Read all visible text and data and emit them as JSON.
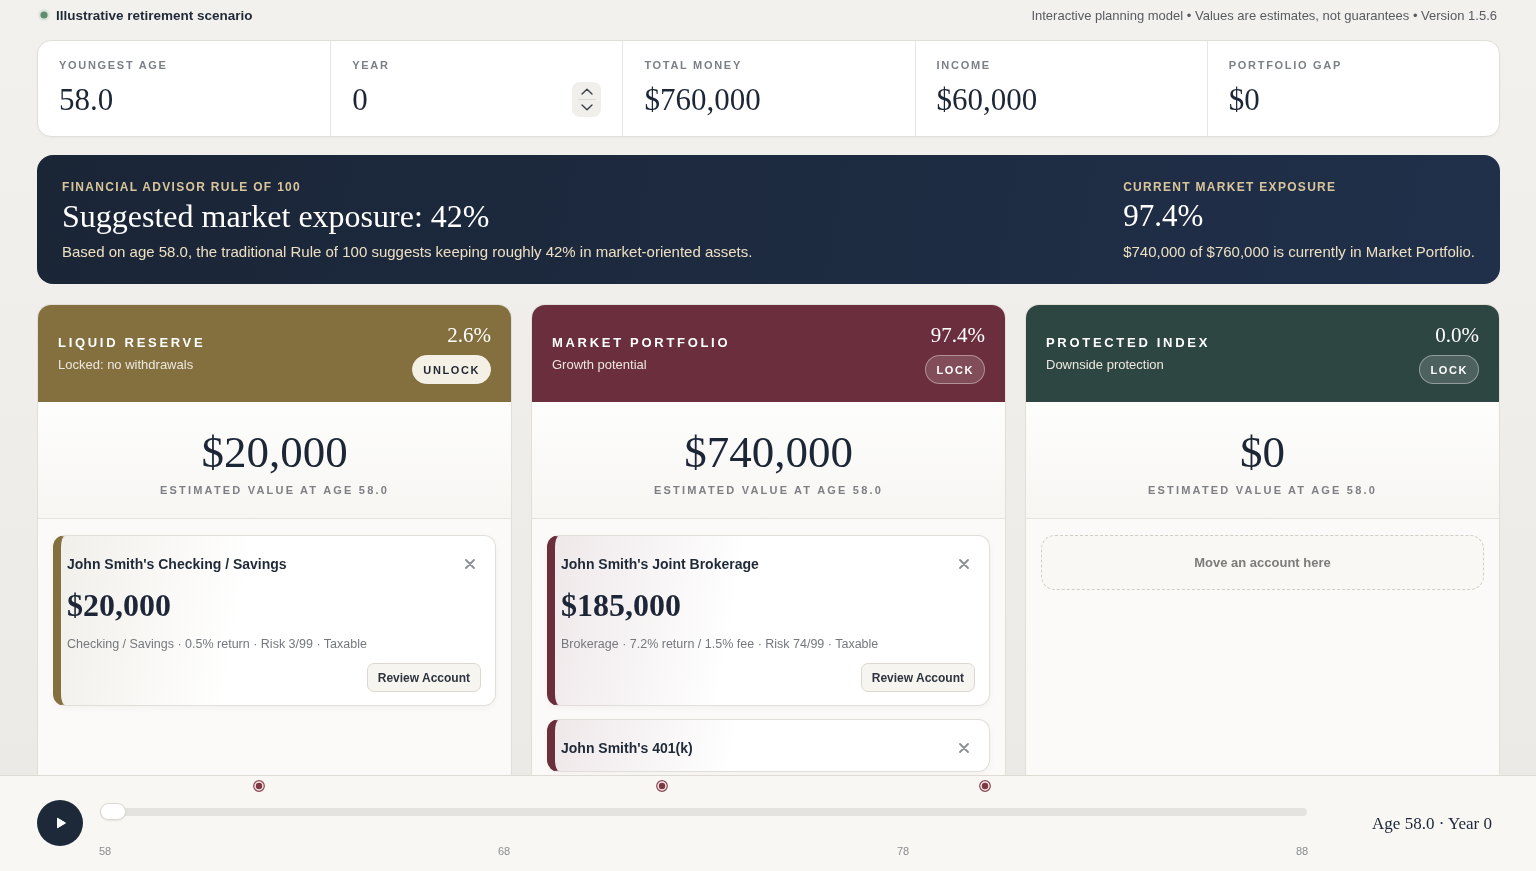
{
  "header": {
    "title": "Illustrative retirement scenario",
    "note": "Interactive planning model • Values are estimates, not guarantees • Version 1.5.6"
  },
  "stats": [
    {
      "label": "YOUNGEST AGE",
      "value": "58.0",
      "kind": "readout"
    },
    {
      "label": "YEAR",
      "value": "0",
      "kind": "number-input"
    },
    {
      "label": "TOTAL MONEY",
      "value": "$760,000",
      "kind": "readout"
    },
    {
      "label": "INCOME",
      "value": "$60,000",
      "kind": "readout"
    },
    {
      "label": "PORTFOLIO GAP",
      "value": "$0",
      "kind": "readout"
    }
  ],
  "rule_banner": {
    "label": "FINANCIAL ADVISOR RULE OF 100",
    "title": "Suggested market exposure: 42%",
    "description": "Based on age 58.0, the traditional Rule of 100 suggests keeping roughly 42% in market-oriented assets.",
    "exposure": {
      "label": "CURRENT MARKET EXPOSURE",
      "value": "97.4%",
      "description": "$740,000 of $760,000 is currently in Market Portfolio."
    }
  },
  "buckets": [
    {
      "title": "LIQUID RESERVE",
      "subtitle": "Locked: no withdrawals",
      "share": "2.6%",
      "locked": true,
      "button": "UNLOCK",
      "color": "#84703f",
      "value": "$20,000",
      "value_label": "ESTIMATED VALUE AT AGE 58.0",
      "accounts": [
        {
          "name": "John Smith's Checking / Savings",
          "amount": "$20,000",
          "details": "Checking / Savings · 0.5% return · Risk 3/99 · Taxable",
          "button": "Review Account"
        }
      ]
    },
    {
      "title": "MARKET PORTFOLIO",
      "subtitle": "Growth potential",
      "share": "97.4%",
      "locked": false,
      "button": "LOCK",
      "color": "#6b2e3c",
      "value": "$740,000",
      "value_label": "ESTIMATED VALUE AT AGE 58.0",
      "accounts": [
        {
          "name": "John Smith's Joint Brokerage",
          "amount": "$185,000",
          "details": "Brokerage · 7.2% return / 1.5% fee · Risk 74/99 · Taxable",
          "button": "Review Account"
        },
        {
          "name": "John Smith's 401(k)"
        }
      ]
    },
    {
      "title": "PROTECTED INDEX",
      "subtitle": "Downside protection",
      "share": "0.0%",
      "locked": false,
      "button": "LOCK",
      "color": "#2e4642",
      "value": "$0",
      "value_label": "ESTIMATED VALUE AT AGE 58.0",
      "empty_hint": "Move an account here"
    }
  ],
  "timeline": {
    "playing": false,
    "level": 0,
    "ticks": [
      "58",
      "68",
      "78",
      "88"
    ],
    "readout": "Age 58.0 · Year 0"
  }
}
